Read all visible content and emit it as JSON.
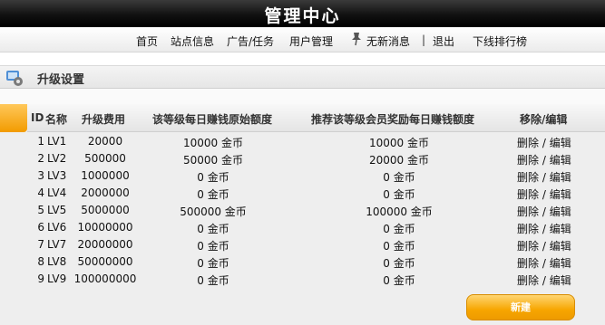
{
  "app": {
    "title": "管理中心"
  },
  "nav": {
    "home": "首页",
    "site_info": "站点信息",
    "ads_tasks": "广告/任务",
    "user_manage": "用户管理",
    "messages": "无新消息",
    "separator": "|",
    "logout": "退出",
    "offline_rank": "下线排行榜"
  },
  "panel": {
    "title": "升级设置"
  },
  "table": {
    "headers": {
      "id": "ID",
      "name": "名称",
      "fee": "升级费用",
      "base": "该等级每日赚钱原始额度",
      "reward": "推荐该等级会员奖励每日赚钱额度",
      "ops": "移除/编辑"
    },
    "rows": [
      {
        "id": "1",
        "name": "LV1",
        "fee": "20000",
        "base": "10000 金币",
        "reward": "10000 金币",
        "delete": "删除",
        "sep": "/",
        "edit": "编辑"
      },
      {
        "id": "2",
        "name": "LV2",
        "fee": "500000",
        "base": "50000 金币",
        "reward": "20000 金币",
        "delete": "删除",
        "sep": "/",
        "edit": "编辑"
      },
      {
        "id": "3",
        "name": "LV3",
        "fee": "1000000",
        "base": "0 金币",
        "reward": "0 金币",
        "delete": "删除",
        "sep": "/",
        "edit": "编辑"
      },
      {
        "id": "4",
        "name": "LV4",
        "fee": "2000000",
        "base": "0 金币",
        "reward": "0 金币",
        "delete": "删除",
        "sep": "/",
        "edit": "编辑"
      },
      {
        "id": "5",
        "name": "LV5",
        "fee": "5000000",
        "base": "500000 金币",
        "reward": "100000 金币",
        "delete": "删除",
        "sep": "/",
        "edit": "编辑"
      },
      {
        "id": "6",
        "name": "LV6",
        "fee": "10000000",
        "base": "0 金币",
        "reward": "0 金币",
        "delete": "删除",
        "sep": "/",
        "edit": "编辑"
      },
      {
        "id": "7",
        "name": "LV7",
        "fee": "20000000",
        "base": "0 金币",
        "reward": "0 金币",
        "delete": "删除",
        "sep": "/",
        "edit": "编辑"
      },
      {
        "id": "8",
        "name": "LV8",
        "fee": "50000000",
        "base": "0 金币",
        "reward": "0 金币",
        "delete": "删除",
        "sep": "/",
        "edit": "编辑"
      },
      {
        "id": "9",
        "name": "LV9",
        "fee": "100000000",
        "base": "0 金币",
        "reward": "0 金币",
        "delete": "删除",
        "sep": "/",
        "edit": "编辑"
      }
    ]
  },
  "actions": {
    "create": "新建"
  },
  "colors": {
    "accent": "#f29b00",
    "topbar": "#111111"
  },
  "icons": {
    "messages": "pin-icon",
    "panel": "settings-gear-icon"
  }
}
